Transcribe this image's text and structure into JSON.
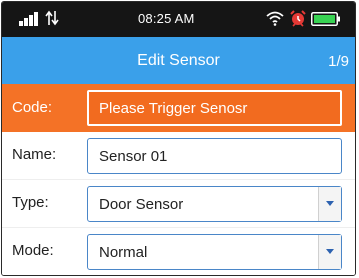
{
  "status_bar": {
    "time": "08:25 AM",
    "icons": [
      "signal-icon",
      "data-transfer-icon",
      "wifi-icon",
      "alarm-clock-icon",
      "battery-icon"
    ]
  },
  "header": {
    "title": "Edit Sensor",
    "page_indicator": "1/9",
    "color": "#3aa0ea"
  },
  "code_row": {
    "label": "Code:",
    "value": "Please Trigger Senosr",
    "color": "#f47226"
  },
  "form": {
    "name": {
      "label": "Name:",
      "value": "Sensor 01"
    },
    "type": {
      "label": "Type:",
      "value": "Door Sensor"
    },
    "mode": {
      "label": "Mode:",
      "value": "Normal"
    }
  }
}
